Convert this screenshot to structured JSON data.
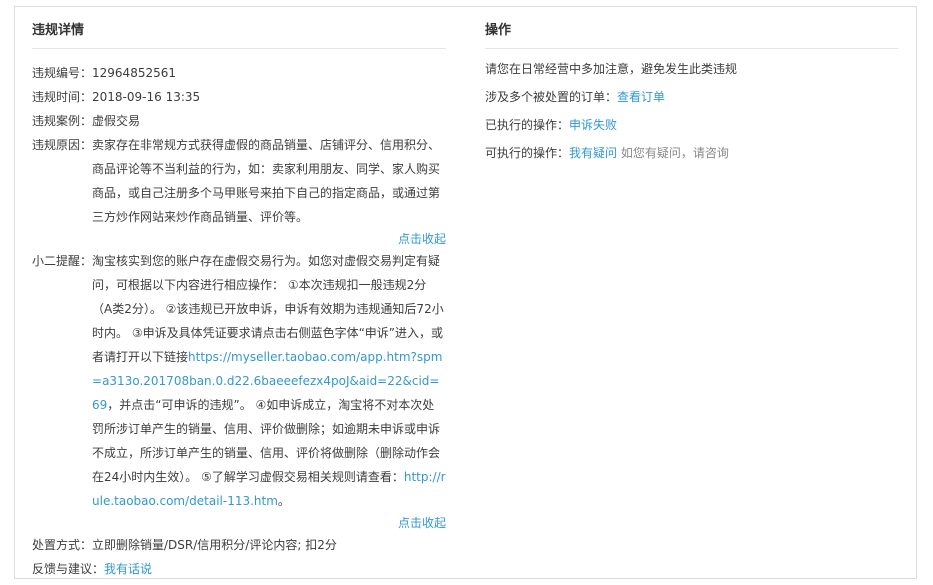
{
  "left": {
    "title": "违规详情",
    "number": {
      "label": "违规编号：",
      "value": "12964852561"
    },
    "time": {
      "label": "违规时间：",
      "value": "2018-09-16 13:35"
    },
    "case": {
      "label": "违规案例：",
      "value": "虚假交易"
    },
    "reason": {
      "label": "违规原因：",
      "text": "卖家存在非常规方式获得虚假的商品销量、店铺评分、信用积分、商品评论等不当利益的行为，如：卖家利用朋友、同学、家人购买商品，或自己注册多个马甲账号来拍下自己的指定商品，或通过第三方炒作网站来炒作商品销量、评价等。"
    },
    "collapse_label": "点击收起",
    "reminder": {
      "label": "小二提醒：",
      "text1": "淘宝核实到您的账户存在虚假交易行为。如您对虚假交易判定有疑问，可根据以下内容进行相应操作： ①本次违规扣一般违规2分（A类2分）。 ②该违规已开放申诉，申诉有效期为违规通知后72小时内。 ③申诉及具体凭证要求请点击右侧蓝色字体“申诉”进入，或者请打开以下链接",
      "link1": "https://myseller.taobao.com/app.htm?spm=a313o.201708ban.0.d22.6baeeefezx4poJ&aid=22&cid=69",
      "text2": "，并点击“可申诉的违规”。 ④如申诉成立，淘宝将不对本次处罚所涉订单产生的销量、信用、评价做删除；如逾期未申诉或申诉不成立，所涉订单产生的销量、信用、评价将做删除（删除动作会在24小时内生效）。 ⑤了解学习虚假交易相关规则请查看：",
      "link2": "http://rule.taobao.com/detail-113.htm",
      "text3": "。"
    },
    "handling": {
      "label": "处置方式：",
      "value": "立即删除销量/DSR/信用积分/评论内容; 扣2分"
    },
    "feedback": {
      "label": "反馈与建议：",
      "link": "我有话说"
    }
  },
  "right": {
    "title": "操作",
    "notice": "请您在日常经营中多加注意，避免发生此类违规",
    "orders": {
      "label": "涉及多个被处置的订单：",
      "link": "查看订单"
    },
    "executed": {
      "label": "已执行的操作：",
      "link": "申诉失败"
    },
    "available": {
      "label": "可执行的操作：",
      "link": "我有疑问",
      "hint": "如您有疑问，请咨询"
    }
  },
  "colors": {
    "link": "#3399cc",
    "text": "#3d3d3d",
    "border": "#dcdcdc"
  }
}
